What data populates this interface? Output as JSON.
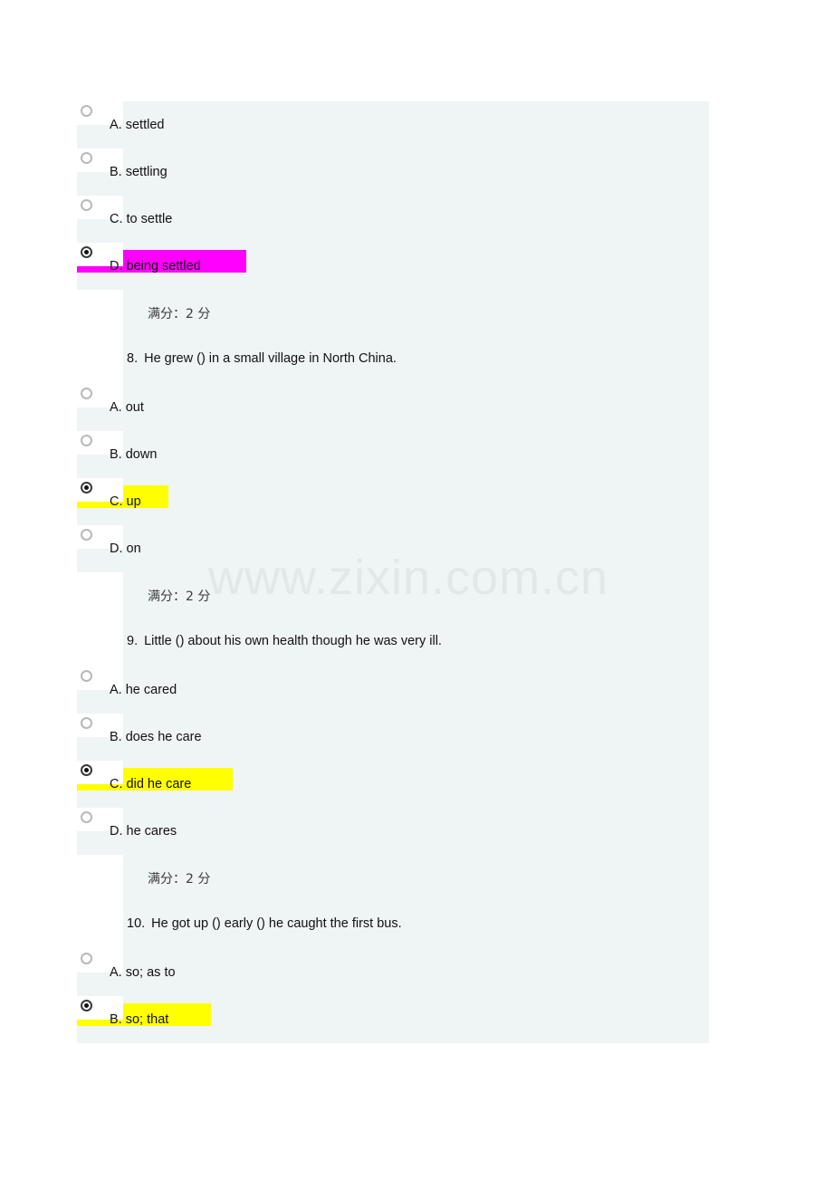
{
  "page": {
    "watermark": "www.zixin.com.cn",
    "panel_background": "#eff4f5",
    "highlight_yellow": "#ffff00",
    "highlight_magenta": "#ff00ff"
  },
  "quiz": {
    "score_label": "满分：2 分",
    "blocks": [
      {
        "type": "options",
        "options": [
          {
            "label": "A. settled",
            "selected": false,
            "highlight": "none"
          },
          {
            "label": "B. settling",
            "selected": false,
            "highlight": "none"
          },
          {
            "label": "C. to settle",
            "selected": false,
            "highlight": "none"
          },
          {
            "label": "D. being settled",
            "selected": true,
            "highlight": "magenta"
          }
        ]
      },
      {
        "type": "score",
        "text": "满分：2 分"
      },
      {
        "type": "question",
        "number": "8.",
        "text": "He grew () in a small village in North China."
      },
      {
        "type": "options",
        "options": [
          {
            "label": "A. out",
            "selected": false,
            "highlight": "none"
          },
          {
            "label": "B. down",
            "selected": false,
            "highlight": "none"
          },
          {
            "label": "C. up",
            "selected": true,
            "highlight": "yellow"
          },
          {
            "label": "D. on",
            "selected": false,
            "highlight": "none"
          }
        ]
      },
      {
        "type": "score",
        "text": "满分：2 分"
      },
      {
        "type": "question",
        "number": "9.",
        "text": "Little () about his own health though he was very ill."
      },
      {
        "type": "options",
        "options": [
          {
            "label": "A. he cared",
            "selected": false,
            "highlight": "none"
          },
          {
            "label": "B. does he care",
            "selected": false,
            "highlight": "none"
          },
          {
            "label": "C. did he care",
            "selected": true,
            "highlight": "yellow"
          },
          {
            "label": "D. he cares",
            "selected": false,
            "highlight": "none"
          }
        ]
      },
      {
        "type": "score",
        "text": "满分：2 分"
      },
      {
        "type": "question",
        "number": "10.",
        "text": "He got up () early () he caught the first bus."
      },
      {
        "type": "options",
        "options": [
          {
            "label": "A. so; as to",
            "selected": false,
            "highlight": "none"
          },
          {
            "label": "B. so; that",
            "selected": true,
            "highlight": "yellow"
          }
        ]
      }
    ]
  }
}
